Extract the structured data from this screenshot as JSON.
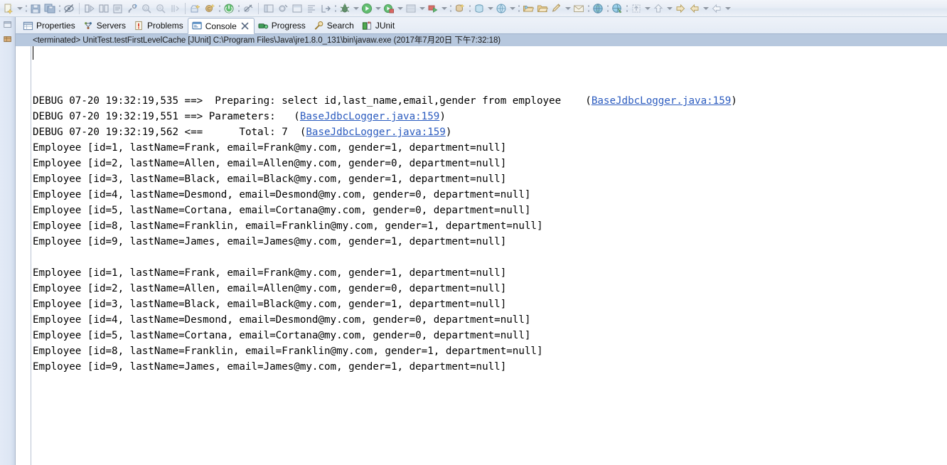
{
  "toolbar": {
    "items": [
      {
        "icon": "new-wizard-icon",
        "arrow": true
      },
      {
        "sep": "dots"
      },
      {
        "icon": "save-icon",
        "arrow": false
      },
      {
        "icon": "save-all-icon",
        "arrow": false
      },
      {
        "sep": "dots"
      },
      {
        "icon": "toggle-mark-occurrences-icon",
        "arrow": false
      },
      {
        "sep": "line"
      },
      {
        "icon": "next-annotation-icon",
        "arrow": false
      },
      {
        "icon": "previous-annotation-icon",
        "arrow": false
      },
      {
        "icon": "print-icon",
        "arrow": false
      },
      {
        "icon": "build-icon",
        "arrow": false
      },
      {
        "icon": "search-declaration-icon",
        "arrow": false
      },
      {
        "icon": "search-references-icon",
        "arrow": false
      },
      {
        "icon": "open-type-icon",
        "arrow": false
      },
      {
        "sep": "line"
      },
      {
        "icon": "new-java-project-icon",
        "arrow": false
      },
      {
        "icon": "new-java-class-icon",
        "arrow": false
      },
      {
        "sep": "dots"
      },
      {
        "icon": "terminate-icon",
        "arrow": false
      },
      {
        "sep": "dots"
      },
      {
        "icon": "skip-breakpoints-icon",
        "arrow": false
      },
      {
        "sep": "line"
      },
      {
        "icon": "open-perspective-icon",
        "arrow": false
      },
      {
        "icon": "external-tools-icon",
        "arrow": false
      },
      {
        "icon": "toggle-breadcrumb-icon",
        "arrow": false
      },
      {
        "icon": "format-icon",
        "arrow": false
      },
      {
        "icon": "export-icon",
        "arrow": false
      },
      {
        "sep": "dots"
      },
      {
        "icon": "debug-icon",
        "arrow": true
      },
      {
        "icon": "run-icon",
        "arrow": true
      },
      {
        "icon": "coverage-icon",
        "arrow": true
      },
      {
        "icon": "server-icon",
        "arrow": true
      },
      {
        "icon": "run-last-tool-icon",
        "arrow": true
      },
      {
        "sep": "dots"
      },
      {
        "icon": "new-connection-icon",
        "arrow": false
      },
      {
        "sep": "dots"
      },
      {
        "icon": "database-icon",
        "arrow": true
      },
      {
        "icon": "sql-scrapbook-icon",
        "arrow": true
      },
      {
        "sep": "dots"
      },
      {
        "icon": "open-folder-icon",
        "arrow": false
      },
      {
        "icon": "open-file-icon",
        "arrow": false
      },
      {
        "icon": "edit-icon",
        "arrow": true
      },
      {
        "icon": "mail-icon",
        "arrow": false
      },
      {
        "sep": "dots"
      },
      {
        "icon": "globe-icon",
        "arrow": false
      },
      {
        "sep": "dots"
      },
      {
        "icon": "web-browser-icon",
        "arrow": false
      },
      {
        "sep": "dots"
      },
      {
        "icon": "pin-editor-icon",
        "arrow": true
      },
      {
        "icon": "up-arrow-icon",
        "arrow": true
      },
      {
        "icon": "back-nav-icon",
        "arrow": false
      },
      {
        "icon": "forward-nav-icon",
        "arrow": true
      },
      {
        "icon": "next-edit-icon",
        "arrow": true
      }
    ]
  },
  "fastview": {
    "buttons": [
      {
        "name": "restore-view-icon"
      },
      {
        "name": "package-explorer-fastview-icon"
      }
    ]
  },
  "tabs": [
    {
      "label": "Properties",
      "icon": "properties-icon",
      "active": false,
      "closable": false
    },
    {
      "label": "Servers",
      "icon": "servers-icon",
      "active": false,
      "closable": false
    },
    {
      "label": "Problems",
      "icon": "problems-icon",
      "active": false,
      "closable": false
    },
    {
      "label": "Console",
      "icon": "console-icon",
      "active": true,
      "closable": true
    },
    {
      "label": "Progress",
      "icon": "progress-icon",
      "active": false,
      "closable": false
    },
    {
      "label": "Search",
      "icon": "search-icon",
      "active": false,
      "closable": false
    },
    {
      "label": "JUnit",
      "icon": "junit-icon",
      "active": false,
      "closable": false
    }
  ],
  "console_header": {
    "text": "<terminated> UnitTest.testFirstLevelCache [JUnit] C:\\Program Files\\Java\\jre1.8.0_131\\bin\\javaw.exe (2017年7月20日 下午7:32:18)"
  },
  "console": {
    "link_text": "BaseJdbcLogger.java:159",
    "lines": [
      {
        "type": "debug",
        "pre": "DEBUG 07-20 19:32:19,535 ==>  Preparing: select id,last_name,email,gender from employee    (",
        "link": "BaseJdbcLogger.java:159",
        "post": ")"
      },
      {
        "type": "debug",
        "pre": "DEBUG 07-20 19:32:19,551 ==> Parameters:   (",
        "link": "BaseJdbcLogger.java:159",
        "post": ")"
      },
      {
        "type": "debug",
        "pre": "DEBUG 07-20 19:32:19,562 <==      Total: 7  (",
        "link": "BaseJdbcLogger.java:159",
        "post": ")"
      },
      {
        "type": "text",
        "text": "Employee [id=1, lastName=Frank, email=Frank@my.com, gender=1, department=null]"
      },
      {
        "type": "text",
        "text": "Employee [id=2, lastName=Allen, email=Allen@my.com, gender=0, department=null]"
      },
      {
        "type": "text",
        "text": "Employee [id=3, lastName=Black, email=Black@my.com, gender=1, department=null]"
      },
      {
        "type": "text",
        "text": "Employee [id=4, lastName=Desmond, email=Desmond@my.com, gender=0, department=null]"
      },
      {
        "type": "text",
        "text": "Employee [id=5, lastName=Cortana, email=Cortana@my.com, gender=0, department=null]"
      },
      {
        "type": "text",
        "text": "Employee [id=8, lastName=Franklin, email=Franklin@my.com, gender=1, department=null]"
      },
      {
        "type": "text",
        "text": "Employee [id=9, lastName=James, email=James@my.com, gender=1, department=null]"
      },
      {
        "type": "blank",
        "text": " "
      },
      {
        "type": "text",
        "text": "Employee [id=1, lastName=Frank, email=Frank@my.com, gender=1, department=null]"
      },
      {
        "type": "text",
        "text": "Employee [id=2, lastName=Allen, email=Allen@my.com, gender=0, department=null]"
      },
      {
        "type": "text",
        "text": "Employee [id=3, lastName=Black, email=Black@my.com, gender=1, department=null]"
      },
      {
        "type": "text",
        "text": "Employee [id=4, lastName=Desmond, email=Desmond@my.com, gender=0, department=null]"
      },
      {
        "type": "text",
        "text": "Employee [id=5, lastName=Cortana, email=Cortana@my.com, gender=0, department=null]"
      },
      {
        "type": "text",
        "text": "Employee [id=8, lastName=Franklin, email=Franklin@my.com, gender=1, department=null]"
      },
      {
        "type": "text",
        "text": "Employee [id=9, lastName=James, email=James@my.com, gender=1, department=null]"
      }
    ]
  },
  "colors": {
    "link": "#2b5bbf",
    "console_header_bg": "#b7c8de",
    "toolbar_bg": "#e9eef6",
    "tab_active_bg": "#ffffff",
    "text": "#000000"
  }
}
